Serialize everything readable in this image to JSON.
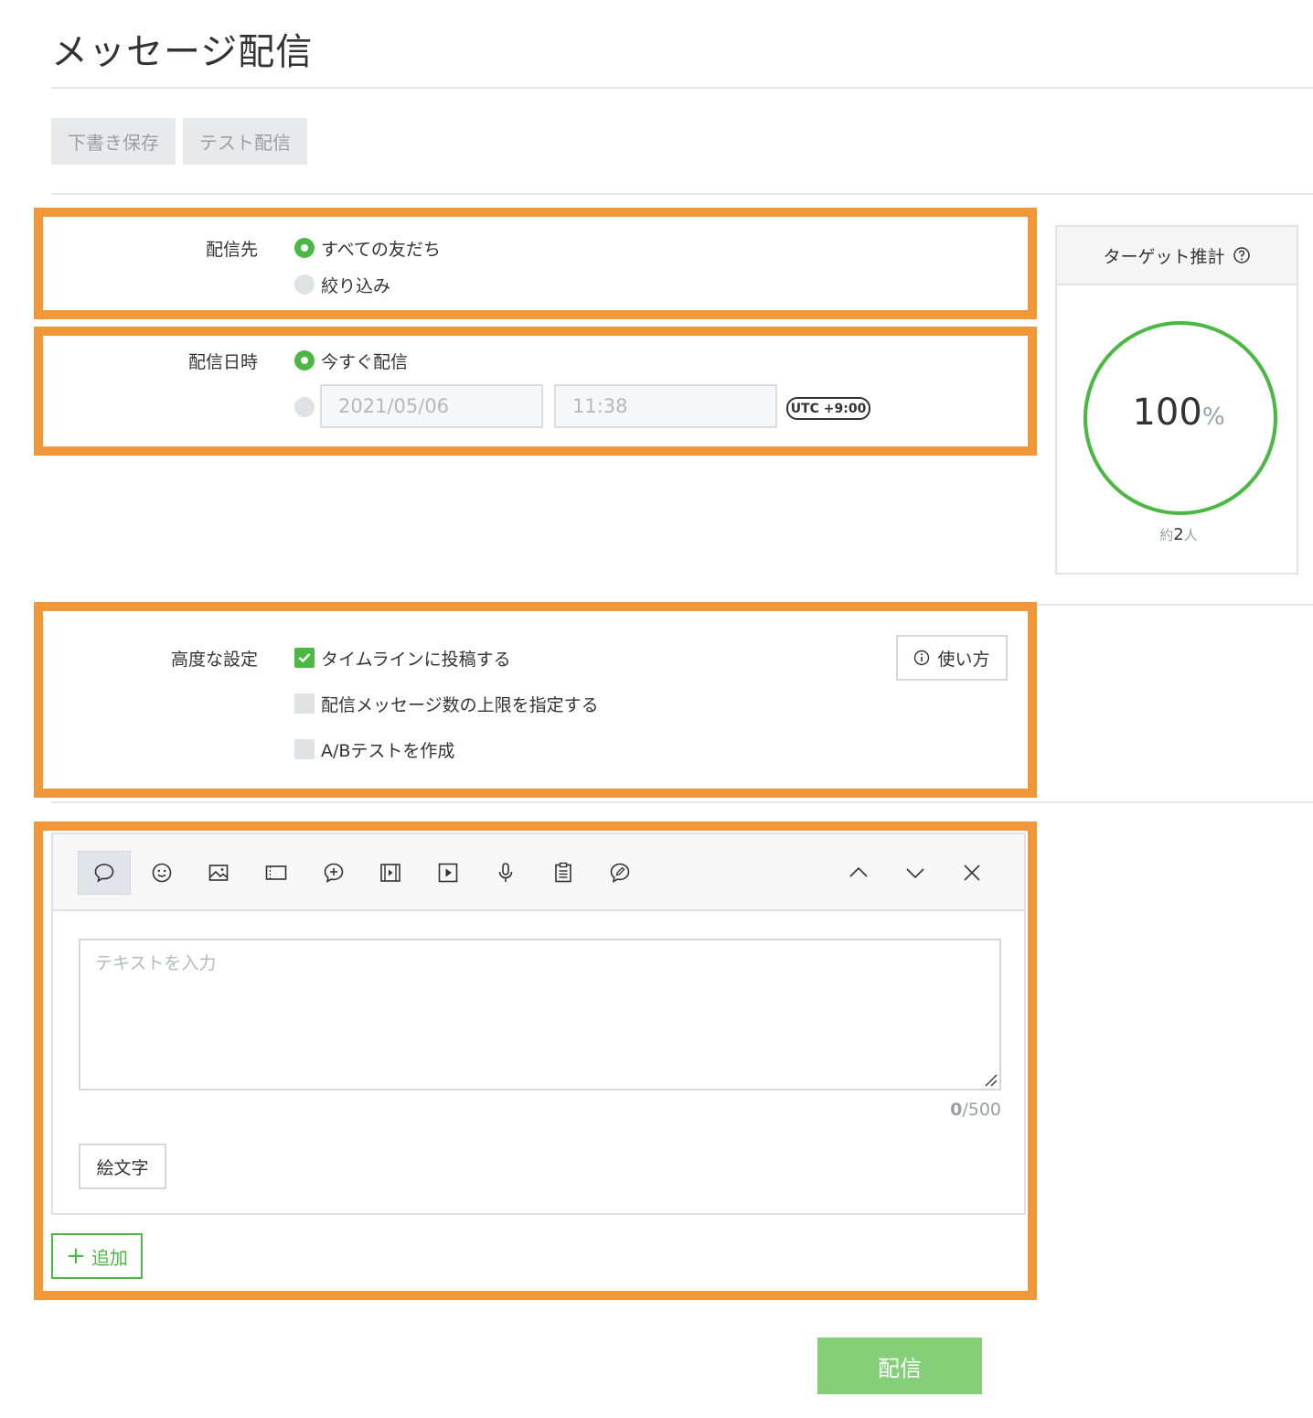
{
  "page": {
    "title": "メッセージ配信"
  },
  "top_actions": {
    "draft_save": "下書き保存",
    "test_send": "テスト配信"
  },
  "recipients": {
    "label": "配信先",
    "options": [
      {
        "label": "すべての友だち",
        "selected": true
      },
      {
        "label": "絞り込み",
        "selected": false
      }
    ]
  },
  "schedule": {
    "label": "配信日時",
    "now_label": "今すぐ配信",
    "date_value": "2021/05/06",
    "time_value": "11:38",
    "timezone": "UTC +9:00"
  },
  "target": {
    "title": "ターゲット推計",
    "percent": "100",
    "percent_unit": "%",
    "approx_prefix": "約",
    "approx_count": "2",
    "approx_unit": "人",
    "ring_fraction": 1.0,
    "ring_color": "#4bb843"
  },
  "advanced": {
    "label": "高度な設定",
    "help_label": "使い方",
    "options": [
      {
        "label": "タイムラインに投稿する",
        "checked": true
      },
      {
        "label": "配信メッセージ数の上限を指定する",
        "checked": false
      },
      {
        "label": "A/Bテストを作成",
        "checked": false
      }
    ]
  },
  "editor": {
    "tools": [
      "speech-bubble-icon",
      "smiley-icon",
      "image-icon",
      "card-icon",
      "chat-plus-icon",
      "film-icon",
      "play-icon",
      "microphone-icon",
      "clipboard-icon",
      "pen-icon"
    ],
    "nav": [
      "chevron-up-icon",
      "chevron-down-icon",
      "close-icon"
    ],
    "text_placeholder": "テキストを入力",
    "count_current": "0",
    "count_max": "/500",
    "emoji_button": "絵文字"
  },
  "add_button": {
    "label": "追加",
    "icon": "+"
  },
  "send_button": {
    "label": "配信"
  },
  "colors": {
    "accent": "#4bb843",
    "highlight_border": "#f0973a",
    "send_bg": "#84cf77"
  }
}
